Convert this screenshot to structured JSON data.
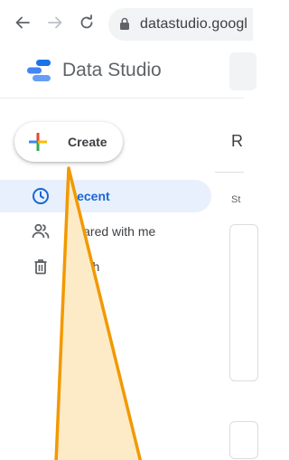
{
  "browser": {
    "url": "datastudio.googl",
    "icons": {
      "back": "back-arrow-icon",
      "forward": "forward-arrow-icon",
      "reload": "reload-icon",
      "lock": "lock-icon"
    }
  },
  "app": {
    "title": "Data Studio",
    "logo": "data-studio-logo"
  },
  "create_button": {
    "label": "Create",
    "icon": "plus-icon"
  },
  "sidebar": {
    "items": [
      {
        "label": "Recent",
        "icon": "clock-icon",
        "active": true
      },
      {
        "label": "Shared with me",
        "icon": "people-icon",
        "active": false
      },
      {
        "label": "Trash",
        "icon": "trash-icon",
        "active": false
      }
    ]
  },
  "main": {
    "title": "R",
    "subtitle": "St"
  },
  "colors": {
    "accent_blue": "#1a73e8",
    "active_bg": "#e8f0fe",
    "annotation_fill": "#fdebc8",
    "annotation_stroke": "#f29900"
  }
}
